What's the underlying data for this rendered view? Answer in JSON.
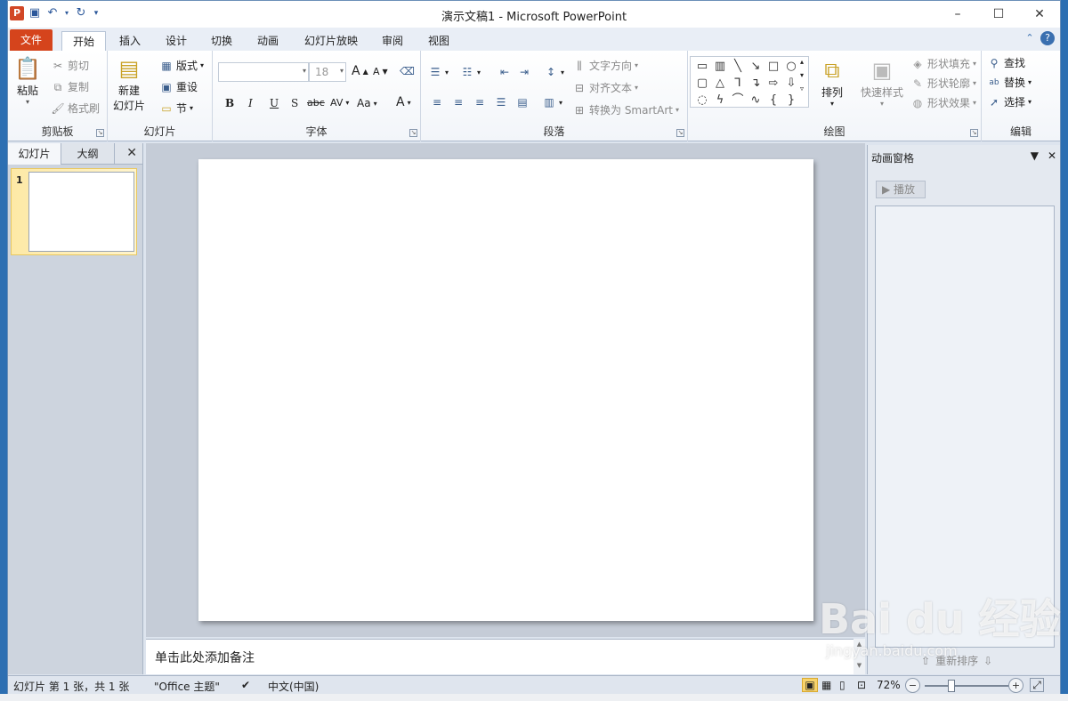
{
  "window": {
    "title": "演示文稿1 - Microsoft PowerPoint",
    "controls": [
      "–",
      "☐",
      "✕"
    ]
  },
  "qat": {
    "app_icon": "P"
  },
  "tabs": {
    "file": "文件",
    "items": [
      "开始",
      "插入",
      "设计",
      "切换",
      "动画",
      "幻灯片放映",
      "审阅",
      "视图"
    ]
  },
  "ribbon": {
    "clipboard": {
      "label": "剪贴板",
      "paste": "粘贴",
      "cut": "剪切",
      "copy": "复制",
      "format_painter": "格式刷"
    },
    "slides": {
      "label": "幻灯片",
      "new_slide_1": "新建",
      "new_slide_2": "幻灯片",
      "layout": "版式",
      "reset": "重设",
      "section": "节"
    },
    "font": {
      "label": "字体",
      "font_size": "18",
      "bold": "B",
      "italic": "I",
      "underline": "U",
      "shadow": "S",
      "strike": "abc",
      "spacing": "AV",
      "case": "Aa",
      "color": "A",
      "grow": "A",
      "shrink": "A"
    },
    "paragraph": {
      "label": "段落",
      "text_direction": "文字方向",
      "align_text": "对齐文本",
      "smartart": "转换为 SmartArt"
    },
    "drawing": {
      "label": "绘图",
      "arrange": "排列",
      "quick_styles": "快速样式",
      "shape_fill": "形状填充",
      "shape_outline": "形状轮廓",
      "shape_effects": "形状效果"
    },
    "editing": {
      "label": "编辑",
      "find": "查找",
      "replace": "替换",
      "select": "选择"
    }
  },
  "left_panel": {
    "tab_slides": "幻灯片",
    "tab_outline": "大纲",
    "slide_number": "1"
  },
  "notes": {
    "placeholder": "单击此处添加备注"
  },
  "animation_pane": {
    "title": "动画窗格",
    "play": "播放",
    "reorder": "重新排序"
  },
  "statusbar": {
    "slide_info": "幻灯片 第 1 张，共 1 张",
    "theme": "\"Office 主题\"",
    "language": "中文(中国)",
    "zoom": "72%"
  },
  "watermark": {
    "logo": "Bai du 经验",
    "url": "jingyan.baidu.com"
  }
}
